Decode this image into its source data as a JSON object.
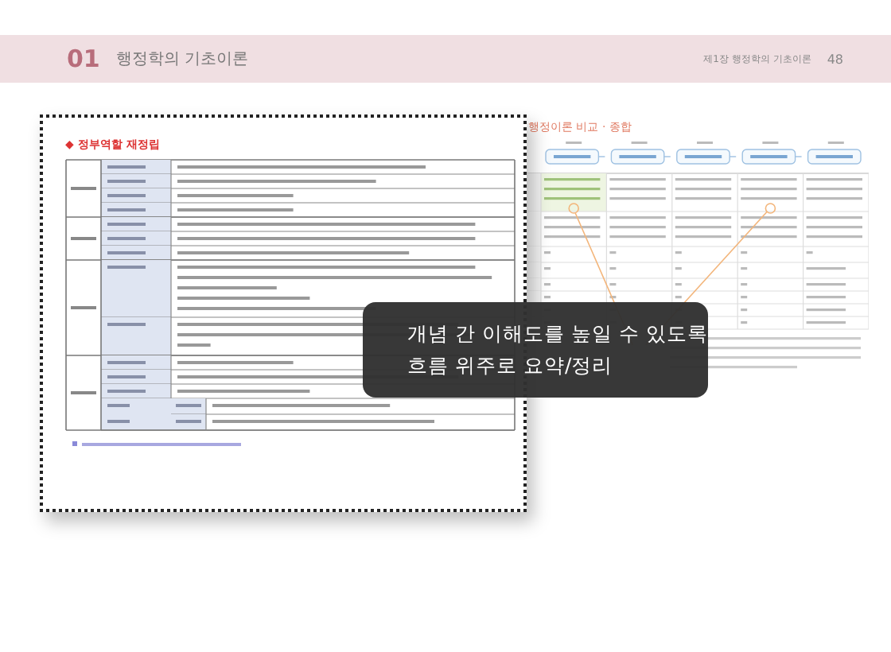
{
  "header": {
    "chapter_number": "01",
    "chapter_title": "행정학의 기초이론",
    "running_title": "제1장 행정학의 기초이론",
    "page_number": "48"
  },
  "right_page": {
    "title": "행정이론 비교 · 종합"
  },
  "card": {
    "title_marker": "◆",
    "title": "정부역할 재정립"
  },
  "callout": [
    "개념 간 이해도를 높일 수 있도록",
    "흐름 위주로 요약/정리"
  ]
}
